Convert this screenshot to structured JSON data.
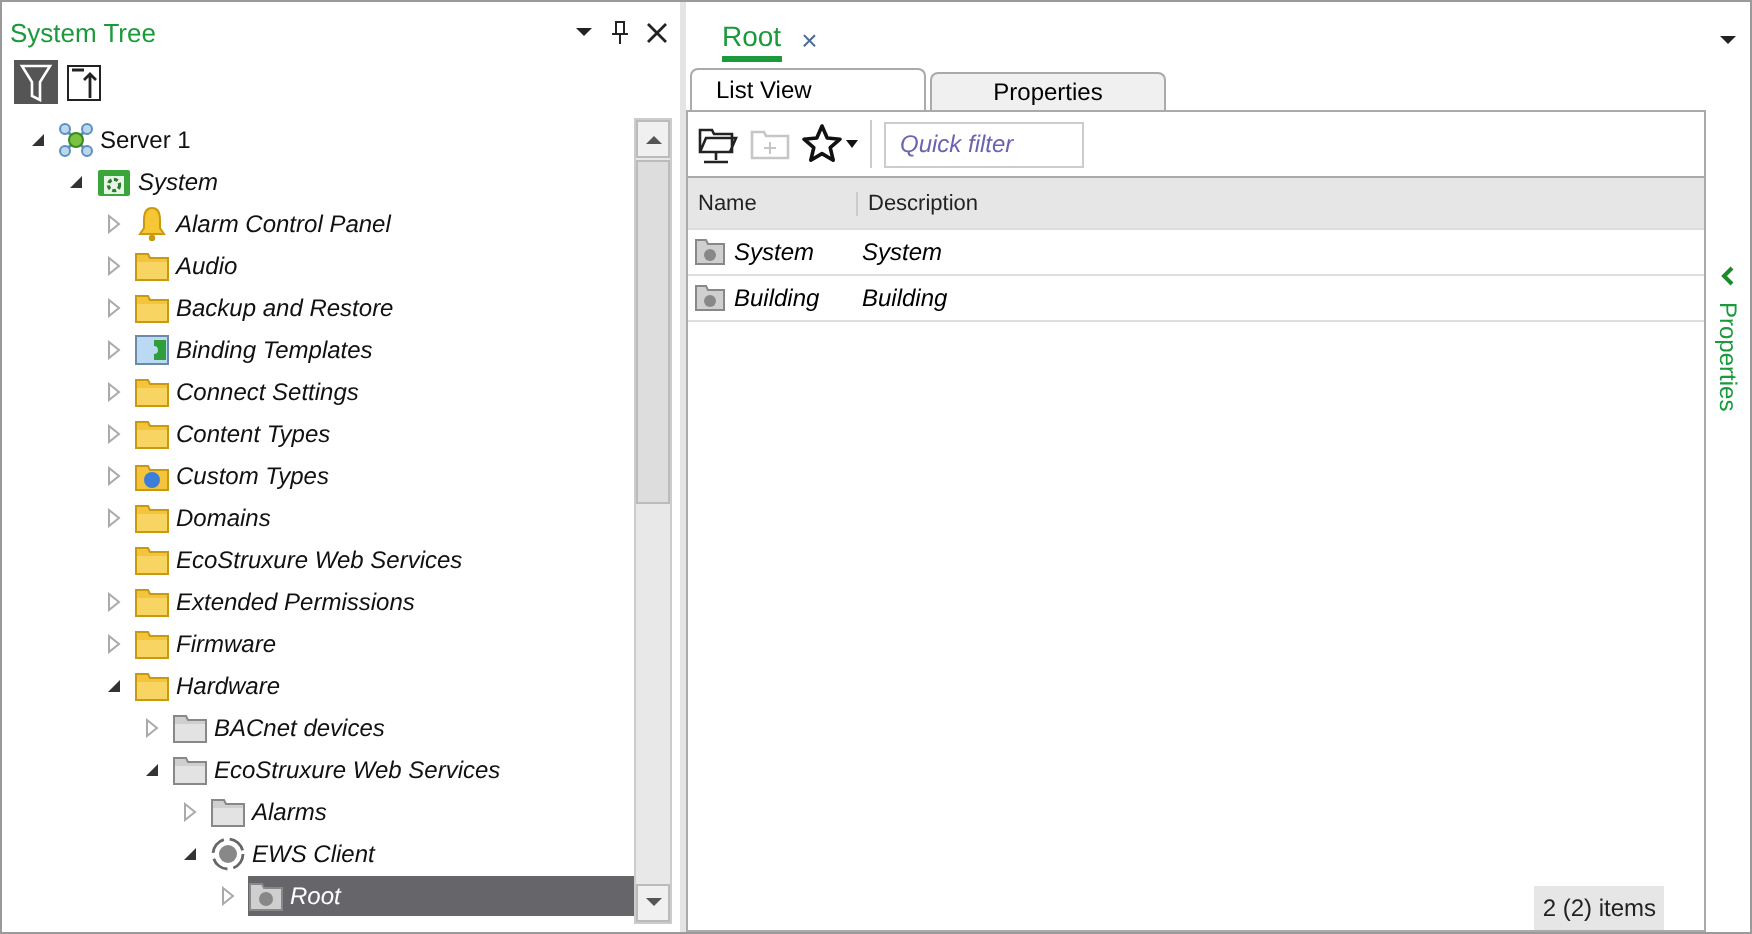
{
  "left_panel": {
    "title": "System Tree",
    "toolbar": [
      {
        "kind": "filter",
        "selected": true
      },
      {
        "kind": "collapse",
        "selected": false
      }
    ],
    "tree": [
      {
        "label": "Server 1",
        "kind": "server",
        "has_children": true,
        "expanded": true,
        "italic": false,
        "selected": false,
        "children": [
          {
            "label": "System",
            "kind": "gear-folder",
            "has_children": true,
            "expanded": true,
            "italic": true,
            "selected": false,
            "children": [
              {
                "label": "Alarm Control Panel",
                "kind": "bell",
                "has_children": true,
                "expanded": false,
                "italic": true,
                "selected": false
              },
              {
                "label": "Audio",
                "kind": "folder",
                "has_children": true,
                "expanded": false,
                "italic": true,
                "selected": false
              },
              {
                "label": "Backup and Restore",
                "kind": "folder",
                "has_children": true,
                "expanded": false,
                "italic": true,
                "selected": false
              },
              {
                "label": "Binding Templates",
                "kind": "binding",
                "has_children": true,
                "expanded": false,
                "italic": true,
                "selected": false
              },
              {
                "label": "Connect Settings",
                "kind": "folder",
                "has_children": true,
                "expanded": false,
                "italic": true,
                "selected": false
              },
              {
                "label": "Content Types",
                "kind": "folder",
                "has_children": true,
                "expanded": false,
                "italic": true,
                "selected": false
              },
              {
                "label": "Custom Types",
                "kind": "custom",
                "has_children": true,
                "expanded": false,
                "italic": true,
                "selected": false
              },
              {
                "label": "Domains",
                "kind": "folder",
                "has_children": true,
                "expanded": false,
                "italic": true,
                "selected": false
              },
              {
                "label": "EcoStruxure Web Services",
                "kind": "folder",
                "has_children": false,
                "italic": true,
                "selected": false
              },
              {
                "label": "Extended Permissions",
                "kind": "folder",
                "has_children": true,
                "expanded": false,
                "italic": true,
                "selected": false
              },
              {
                "label": "Firmware",
                "kind": "folder",
                "has_children": true,
                "expanded": false,
                "italic": true,
                "selected": false
              },
              {
                "label": "Hardware",
                "kind": "folder",
                "has_children": true,
                "expanded": true,
                "italic": true,
                "selected": false,
                "children": [
                  {
                    "label": "BACnet devices",
                    "kind": "gray-folder",
                    "has_children": true,
                    "expanded": false,
                    "italic": true,
                    "selected": false
                  },
                  {
                    "label": "EcoStruxure Web Services",
                    "kind": "gray-folder",
                    "has_children": true,
                    "expanded": true,
                    "italic": true,
                    "selected": false,
                    "children": [
                      {
                        "label": "Alarms",
                        "kind": "gray-folder",
                        "has_children": true,
                        "expanded": false,
                        "italic": true,
                        "selected": false
                      },
                      {
                        "label": "EWS Client",
                        "kind": "client",
                        "has_children": true,
                        "expanded": true,
                        "italic": true,
                        "selected": false,
                        "children": [
                          {
                            "label": "Root",
                            "kind": "root",
                            "has_children": true,
                            "expanded": false,
                            "italic": true,
                            "selected": true
                          }
                        ]
                      }
                    ]
                  }
                ]
              }
            ]
          }
        ]
      }
    ]
  },
  "document": {
    "tab": {
      "label": "Root",
      "close": "×"
    },
    "view_tabs": [
      {
        "label": "List View",
        "selected": true
      },
      {
        "label": "Properties",
        "selected": false
      }
    ],
    "toolbar": [
      {
        "kind": "open-folder",
        "disabled": false
      },
      {
        "kind": "new-folder",
        "disabled": true
      },
      {
        "kind": "favorites",
        "disabled": false
      }
    ],
    "search": {
      "placeholder": "Quick filter"
    },
    "table": {
      "columns": [
        "Name",
        "Description"
      ],
      "rows": [
        {
          "name": "System",
          "description": "System"
        },
        {
          "name": "Building",
          "description": "Building"
        }
      ]
    },
    "status": "2 (2) items",
    "side_tab": "Properties"
  }
}
